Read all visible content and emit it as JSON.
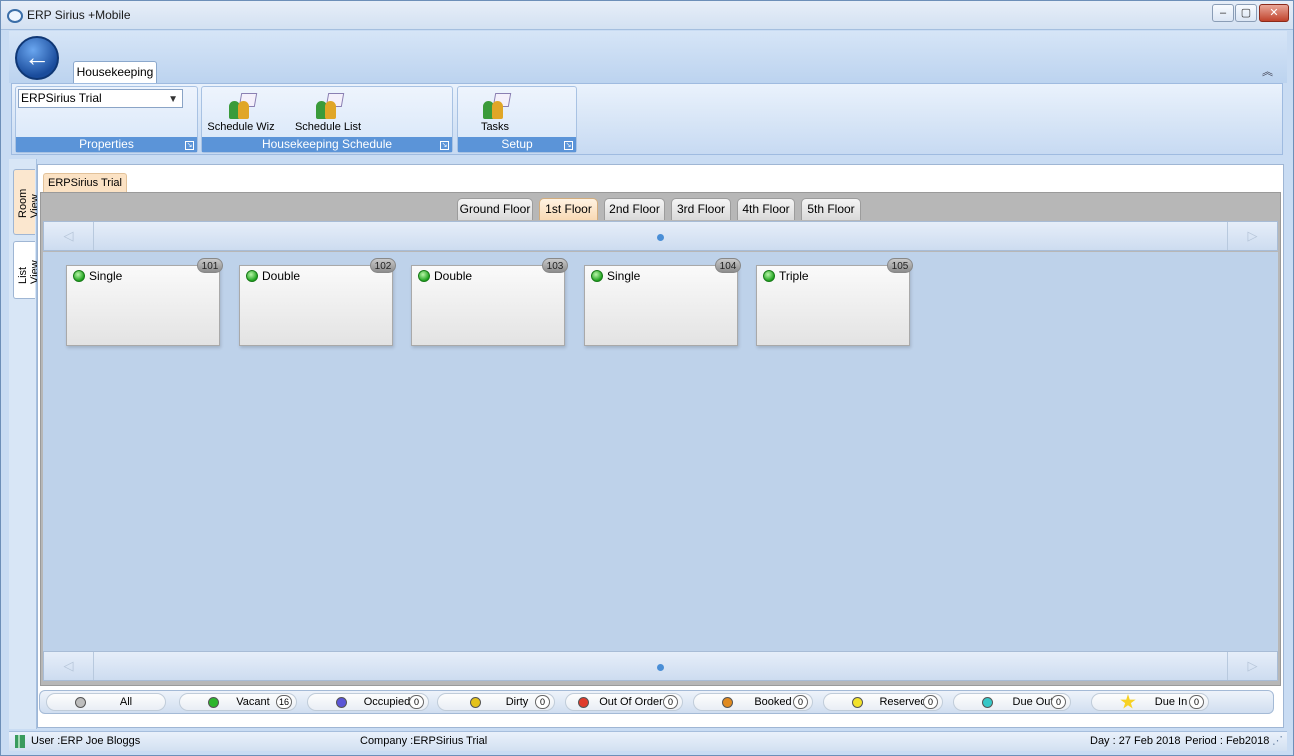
{
  "window": {
    "title": "ERP Sirius +Mobile",
    "controls": {
      "min": "–",
      "max": "▢",
      "close": "✕"
    }
  },
  "ribbon": {
    "back": "←",
    "tab": "Housekeeping",
    "collapse": "︽",
    "properties": {
      "selected": "ERPSirius Trial",
      "label": "Properties"
    },
    "schedule": {
      "wiz": "Schedule Wiz",
      "list": "Schedule List",
      "label": "Housekeeping Schedule"
    },
    "setup": {
      "tasks": "Tasks",
      "label": "Setup"
    }
  },
  "side_tabs": {
    "room_view": "Room View",
    "list_view": "List View"
  },
  "document_tab": "ERPSirius Trial",
  "floor_tabs": [
    "Ground Floor",
    "1st Floor",
    "2nd Floor",
    "3rd Floor",
    "4th Floor",
    "5th Floor"
  ],
  "active_floor": "1st Floor",
  "nav": {
    "prev": "◁",
    "next": "▷"
  },
  "rooms": [
    {
      "number": "101",
      "type": "Single",
      "status": "Vacant"
    },
    {
      "number": "102",
      "type": "Double",
      "status": "Vacant"
    },
    {
      "number": "103",
      "type": "Double",
      "status": "Vacant"
    },
    {
      "number": "104",
      "type": "Single",
      "status": "Vacant"
    },
    {
      "number": "105",
      "type": "Triple",
      "status": "Vacant"
    }
  ],
  "filters": [
    {
      "label": "All",
      "count": "",
      "color": "#bdbdbd"
    },
    {
      "label": "Vacant",
      "count": "16",
      "color": "#2cb52c"
    },
    {
      "label": "Occupied",
      "count": "0",
      "color": "#5b55d6"
    },
    {
      "label": "Dirty",
      "count": "0",
      "color": "#e4c21b"
    },
    {
      "label": "Out Of Order",
      "count": "0",
      "color": "#e03b2b"
    },
    {
      "label": "Booked",
      "count": "0",
      "color": "#e08a20"
    },
    {
      "label": "Reserved",
      "count": "0",
      "color": "#f2e22a"
    },
    {
      "label": "Due Out",
      "count": "0",
      "color": "#36c7c7"
    },
    {
      "label": "Due In",
      "count": "0",
      "color": "#f7d225"
    }
  ],
  "statusbar": {
    "user": "User :ERP Joe Bloggs",
    "company": "Company :ERPSirius Trial",
    "day": "Day : 27 Feb 2018",
    "period": "Period : Feb2018"
  }
}
